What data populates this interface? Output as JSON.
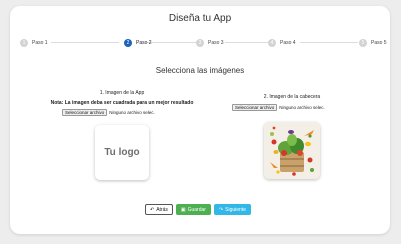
{
  "header": {
    "title": "Diseña tu App"
  },
  "stepper": {
    "steps": [
      {
        "number": "1",
        "label": "Paso 1"
      },
      {
        "number": "2",
        "label": "Paso 2"
      },
      {
        "number": "3",
        "label": "Paso 3"
      },
      {
        "number": "4",
        "label": "Paso 4"
      },
      {
        "number": "5",
        "label": "Paso 5"
      }
    ],
    "active_step": 2,
    "active_color": "#1a63b8"
  },
  "main": {
    "subtitle": "Selecciona las imágenes",
    "app_image": {
      "heading": "1. Imagen de la App",
      "note": "Nota: La imagen deba ser cuadrada para un mejor resultado",
      "file_button": "Seleccionar archivo",
      "file_status": "Ninguno archivo selec.",
      "placeholder_text": "Tu logo"
    },
    "cover_image": {
      "heading": "2. Imagen de la cabecera",
      "file_button": "Seleccionar archivo",
      "file_status": "Ninguno archivo selec."
    }
  },
  "footer": {
    "back_label": "Atrás",
    "back_icon": "undo-icon",
    "save_label": "Guardar",
    "save_icon": "save-icon",
    "save_color": "#4caf50",
    "next_label": "Siguiente",
    "next_icon": "redo-icon",
    "next_color": "#32b8e6"
  }
}
